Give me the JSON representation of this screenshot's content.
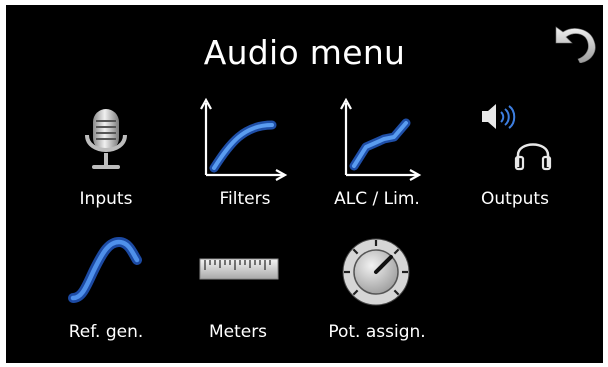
{
  "title": "Audio menu",
  "back_icon": "undo-arrow-icon",
  "colors": {
    "background": "#000000",
    "text": "#ffffff",
    "accent_blue": "#2f6fd6",
    "icon_grey": "#c9c9c9"
  },
  "menu": {
    "items": [
      {
        "label": "Inputs",
        "icon": "microphone-icon"
      },
      {
        "label": "Filters",
        "icon": "filter-curve-icon"
      },
      {
        "label": "ALC / Lim.",
        "icon": "limiter-curve-icon"
      },
      {
        "label": "Outputs",
        "icon": "speaker-headphones-icon"
      },
      {
        "label": "Ref. gen.",
        "icon": "sine-wave-icon"
      },
      {
        "label": "Meters",
        "icon": "ruler-meter-icon"
      },
      {
        "label": "Pot. assign.",
        "icon": "knob-icon"
      }
    ]
  }
}
